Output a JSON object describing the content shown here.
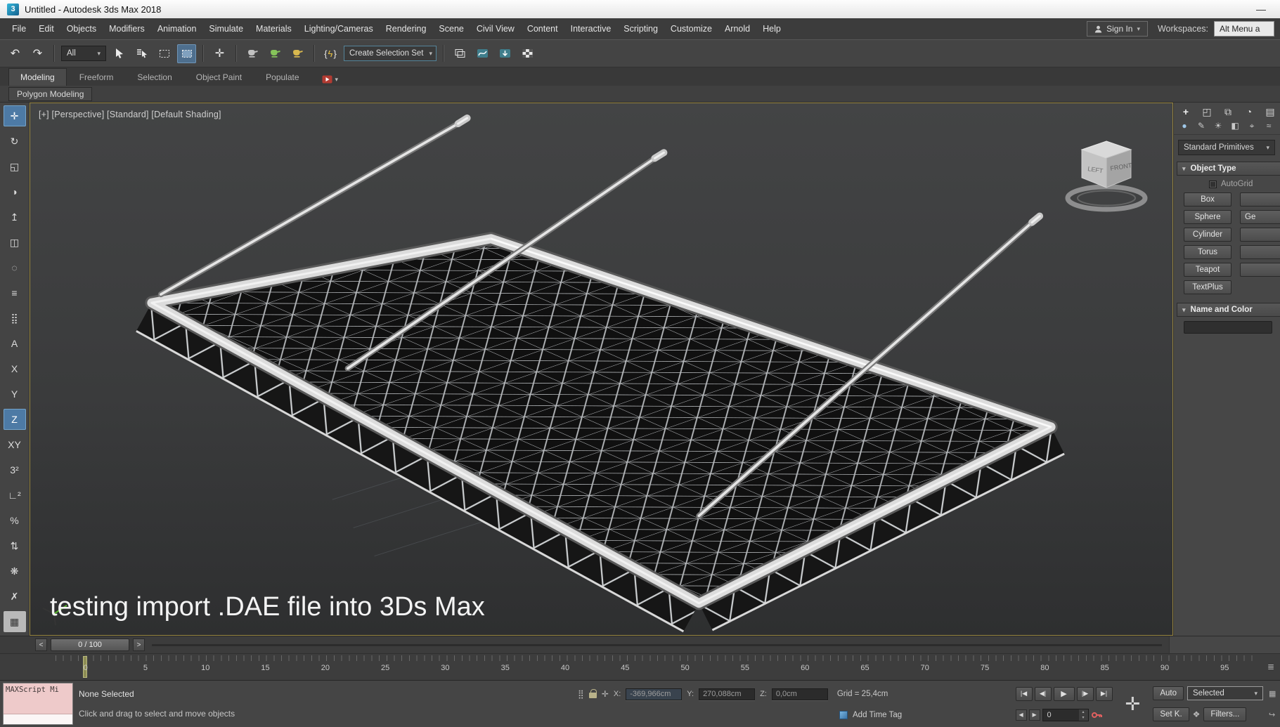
{
  "titlebar": {
    "app_icon": "3",
    "title": "Untitled - Autodesk 3ds Max 2018",
    "minimize": "—"
  },
  "menubar": {
    "items": [
      "File",
      "Edit",
      "Objects",
      "Modifiers",
      "Animation",
      "Simulate",
      "Materials",
      "Lighting/Cameras",
      "Rendering",
      "Scene",
      "Civil View",
      "Content",
      "Interactive",
      "Scripting",
      "Customize",
      "Arnold",
      "Help"
    ],
    "sign_in": "Sign In",
    "workspaces_label": "Workspaces:",
    "workspace_value": "Alt Menu a",
    "dropdown_arrow": "▾"
  },
  "toolbar": {
    "undo": "↶",
    "redo": "↷",
    "filter_value": "All",
    "move_glyph": "✛",
    "script_open": "{",
    "script_bolt": "ϟ",
    "script_close": "}",
    "selection_set": "Create Selection Set",
    "dropdown_arrow": "▾"
  },
  "ribbon": {
    "tabs": [
      "Modeling",
      "Freeform",
      "Selection",
      "Object Paint",
      "Populate"
    ],
    "subtab": "Polygon Modeling",
    "dropdown_arrow": "▾"
  },
  "left_toolbar": {
    "glyphs": [
      "✛",
      "↻",
      "◱",
      "◑",
      "↥",
      "◫",
      "◌",
      "≡",
      "⣿",
      "A",
      "X",
      "Y",
      "Z",
      "XY",
      "3²",
      "∟²",
      "%",
      "⇅",
      "❋",
      "✗",
      "▦"
    ]
  },
  "viewport": {
    "label": "[+] [Perspective] [Standard] [Default Shading]",
    "overlay_text": "testing import .DAE file into 3Ds Max",
    "viewcube": {
      "left": "LEFT",
      "front": "FRONT"
    }
  },
  "command_panel": {
    "tab_icons": [
      "+",
      "◰",
      "⧉",
      "◔",
      "▤",
      "☰"
    ],
    "category_icons": [
      "●",
      "✎",
      "☀",
      "◧",
      "⌖",
      "≈"
    ],
    "dropdown_value": "Standard Primitives",
    "rollout_arrow": "▾",
    "object_type_title": "Object Type",
    "autogrid": "AutoGrid",
    "buttons_col1": [
      "Box",
      "Sphere",
      "Cylinder",
      "Torus",
      "Teapot",
      "TextPlus"
    ],
    "buttons_col2": [
      "",
      "Ge",
      "",
      "",
      ""
    ],
    "name_color_title": "Name and Color"
  },
  "time_slider": {
    "prev": "<",
    "value": "0 / 100",
    "next": ">"
  },
  "timeline": {
    "ticks": [
      "0",
      "5",
      "10",
      "15",
      "20",
      "25",
      "30",
      "35",
      "40",
      "45",
      "50",
      "55",
      "60",
      "65",
      "70",
      "75",
      "80",
      "85",
      "90",
      "95"
    ],
    "edge_icon": "≣"
  },
  "statusbar": {
    "maxscript": "MAXScript Mi",
    "status_line": "None Selected",
    "prompt_line": "Click and drag to select and move objects",
    "dots_icon": "⣿",
    "gizmo_icon": "✛",
    "x_label": "X:",
    "x_value": "-369,966cm",
    "y_label": "Y:",
    "y_value": "270,088cm",
    "z_label": "Z:",
    "z_value": "0,0cm",
    "grid_label": "Grid = 25,4cm",
    "add_time_tag": "Add Time Tag",
    "playback": [
      "|◀",
      "◀|",
      "▶",
      "|▶",
      "▶|"
    ],
    "frame_prev": "◀",
    "frame_next": "▶",
    "frame_value": "0",
    "spin_up": "▴",
    "spin_down": "▾",
    "big_plus": "✛",
    "auto": "Auto",
    "selected": "Selected",
    "set_key": "Set K.",
    "mini_icon": "❖",
    "filters": "Filters...",
    "dropdown_arrow": "▾",
    "edge_icon_top": "▦",
    "edge_icon_bottom": "↪"
  }
}
